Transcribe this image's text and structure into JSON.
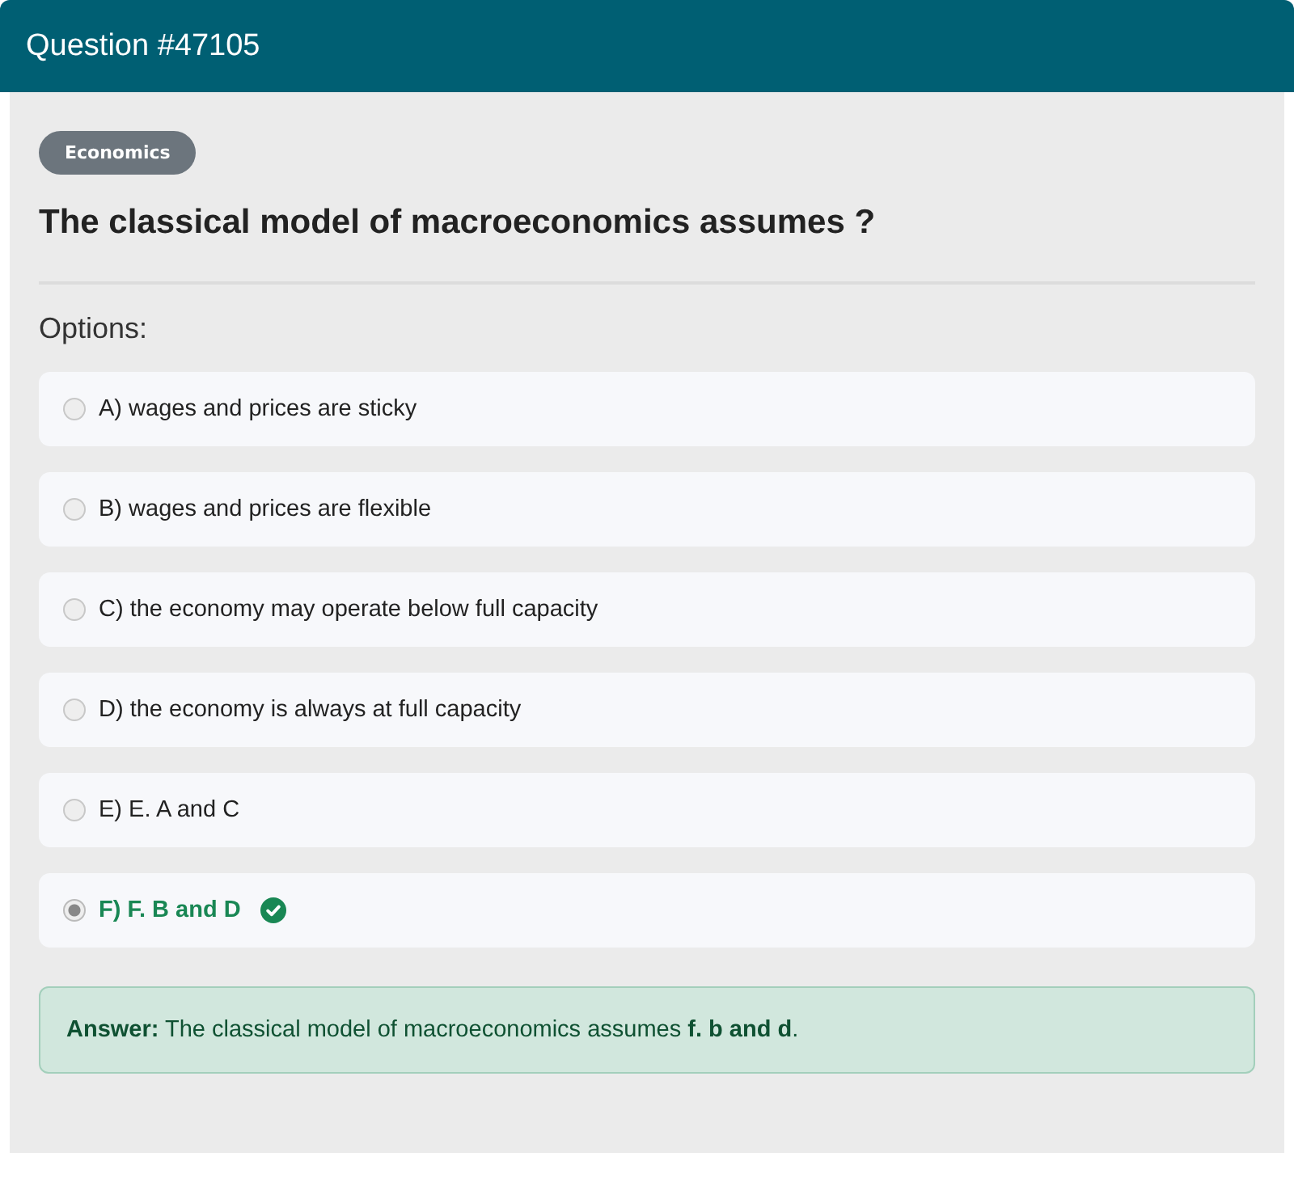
{
  "header": {
    "title": "Question #47105"
  },
  "category": "Economics",
  "question": "The classical model of macroeconomics assumes ?",
  "options_label": "Options:",
  "options": [
    {
      "label": "A) wages and prices are sticky",
      "selected": false,
      "correct": false
    },
    {
      "label": "B) wages and prices are flexible",
      "selected": false,
      "correct": false
    },
    {
      "label": "C) the economy may operate below full capacity",
      "selected": false,
      "correct": false
    },
    {
      "label": "D) the economy is always at full capacity",
      "selected": false,
      "correct": false
    },
    {
      "label": "E) E. A and C",
      "selected": false,
      "correct": false
    },
    {
      "label": "F) F. B and D",
      "selected": true,
      "correct": true
    }
  ],
  "answer": "**Answer:** The classical model of macroeconomics assumes **f. b and d**."
}
